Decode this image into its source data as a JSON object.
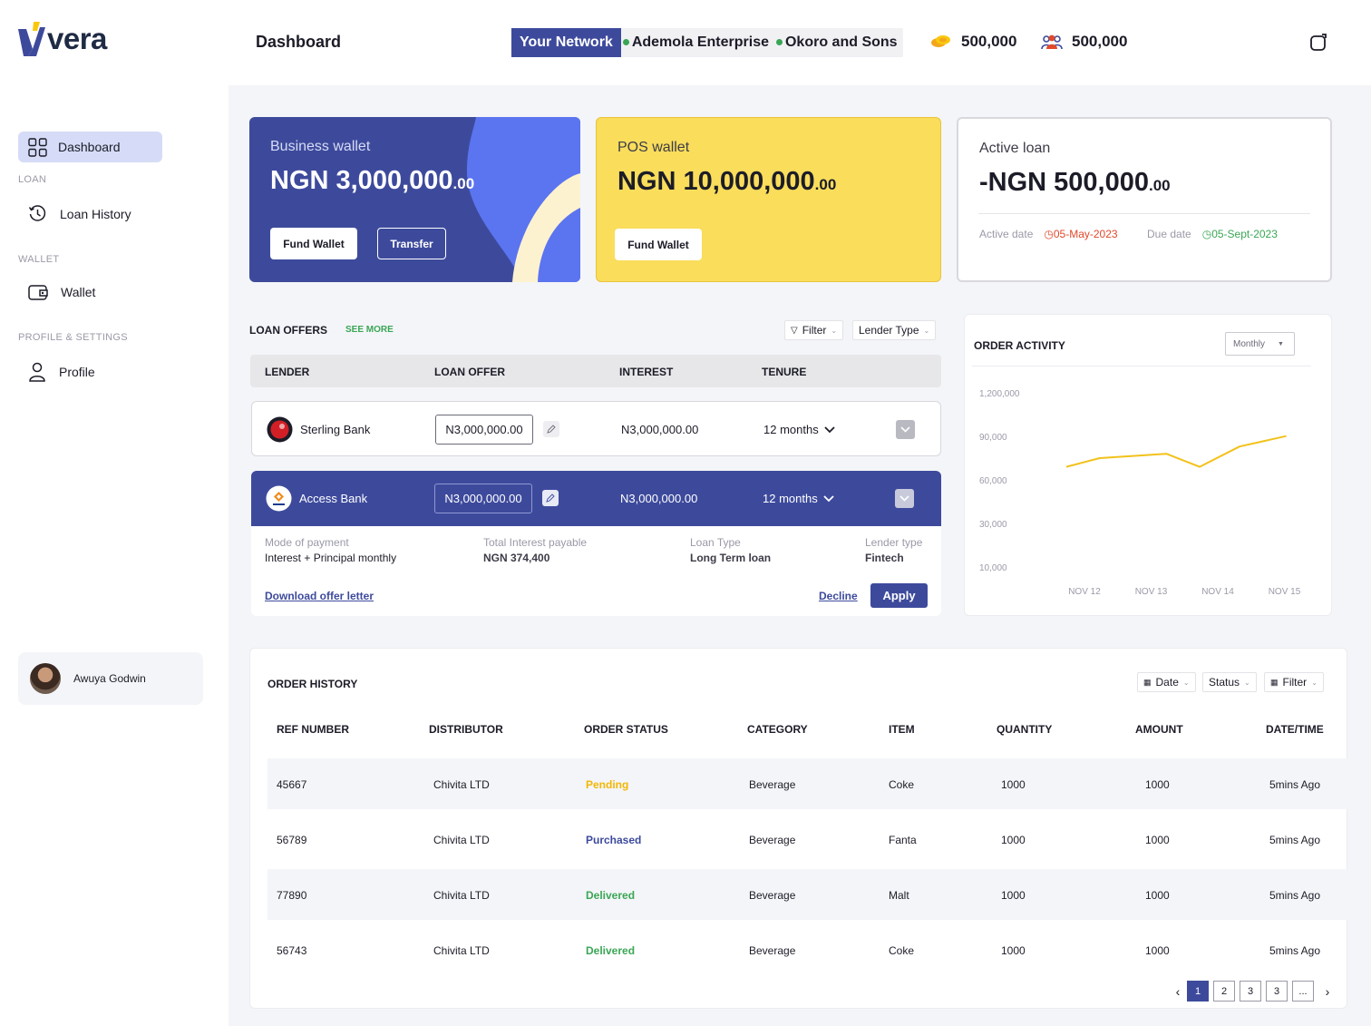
{
  "brand": {
    "name": "vera"
  },
  "header": {
    "title": "Dashboard",
    "network_label": "Your Network",
    "network_items": [
      "Ademola Enterprise",
      "Okoro and Sons"
    ],
    "stat_one": "500,000",
    "stat_two": "500,000"
  },
  "sidebar": {
    "dashboard": "Dashboard",
    "loan_section": "LOAN",
    "loan_history": "Loan History",
    "wallet_section": "WALLET",
    "wallet": "Wallet",
    "profile_section": "PROFILE & SETTINGS",
    "profile": "Profile",
    "user_name": "Awuya Godwin"
  },
  "cards": {
    "business": {
      "label": "Business wallet",
      "amount": "NGN 3,000,000",
      "cents": ".00",
      "fund": "Fund Wallet",
      "transfer": "Transfer"
    },
    "pos": {
      "label": "POS wallet",
      "amount": "NGN 10,000,000",
      "cents": ".00",
      "fund": "Fund Wallet"
    },
    "loan": {
      "label": "Active loan",
      "amount": "-NGN 500,000",
      "cents": ".00",
      "active_label": "Active date",
      "active_date": "05-May-2023",
      "due_label": "Due date",
      "due_date": "05-Sept-2023"
    }
  },
  "loan_offers": {
    "title": "LOAN OFFERS",
    "see_more": "SEE MORE",
    "filter": "Filter",
    "lender_type": "Lender Type",
    "columns": [
      "LENDER",
      "LOAN OFFER",
      "INTEREST",
      "TENURE"
    ],
    "rows": [
      {
        "lender": "Sterling Bank",
        "offer": "N3,000,000.00",
        "interest": "N3,000,000.00",
        "tenure": "12 months"
      },
      {
        "lender": "Access Bank",
        "offer": "N3,000,000.00",
        "interest": "N3,000,000.00",
        "tenure": "12 months"
      }
    ],
    "details": {
      "mode_label": "Mode of payment",
      "mode_value": "Interest +  Principal monthly",
      "total_label": "Total Interest payable",
      "total_value": "NGN 374,400",
      "type_label": "Loan Type",
      "type_value": "Long Term loan",
      "lender_label": "Lender type",
      "lender_value": "Fintech"
    },
    "download": "Download offer letter",
    "decline": "Decline",
    "apply": "Apply"
  },
  "order_activity": {
    "title": "ORDER ACTIVITY",
    "period": "Monthly"
  },
  "chart_data": {
    "type": "line",
    "title": "ORDER ACTIVITY",
    "y_ticks": [
      "1,200,000",
      "90,000",
      "60,000",
      "30,000",
      "10,000"
    ],
    "categories": [
      "NOV 12",
      "NOV 13",
      "NOV 14",
      "NOV 15"
    ],
    "x": [
      0.0,
      0.5,
      1.5,
      2.0,
      2.6,
      3.3
    ],
    "values": [
      69000,
      75000,
      78000,
      69000,
      83000,
      97000
    ],
    "ylim": [
      10000,
      1200000
    ],
    "grid": false,
    "legend": "none",
    "color": "#f2c21b"
  },
  "order_history": {
    "title": "ORDER HISTORY",
    "filters": [
      "Date",
      "Status",
      "Filter"
    ],
    "columns": [
      "REF NUMBER",
      "DISTRIBUTOR",
      "ORDER STATUS",
      "CATEGORY",
      "ITEM",
      "QUANTITY",
      "AMOUNT",
      "DATE/TIME"
    ],
    "rows": [
      {
        "ref": "45667",
        "distributor": "Chivita LTD",
        "status": "Pending",
        "category": "Beverage",
        "item": "Coke",
        "quantity": "1000",
        "amount": "1000",
        "time": "5mins Ago"
      },
      {
        "ref": "56789",
        "distributor": "Chivita LTD",
        "status": "Purchased",
        "category": "Beverage",
        "item": "Fanta",
        "quantity": "1000",
        "amount": "1000",
        "time": "5mins Ago"
      },
      {
        "ref": "77890",
        "distributor": "Chivita LTD",
        "status": "Delivered",
        "category": "Beverage",
        "item": "Malt",
        "quantity": "1000",
        "amount": "1000",
        "time": "5mins Ago"
      },
      {
        "ref": "56743",
        "distributor": "Chivita LTD",
        "status": "Delivered",
        "category": "Beverage",
        "item": "Coke",
        "quantity": "1000",
        "amount": "1000",
        "time": "5mins Ago"
      }
    ],
    "pages": [
      "1",
      "2",
      "3",
      "3",
      "..."
    ]
  },
  "colors": {
    "primary": "#3d4a9c",
    "yellow": "#f9dd5b",
    "green": "#3aa655",
    "red": "#e0492b",
    "pending": "#f2b705"
  }
}
